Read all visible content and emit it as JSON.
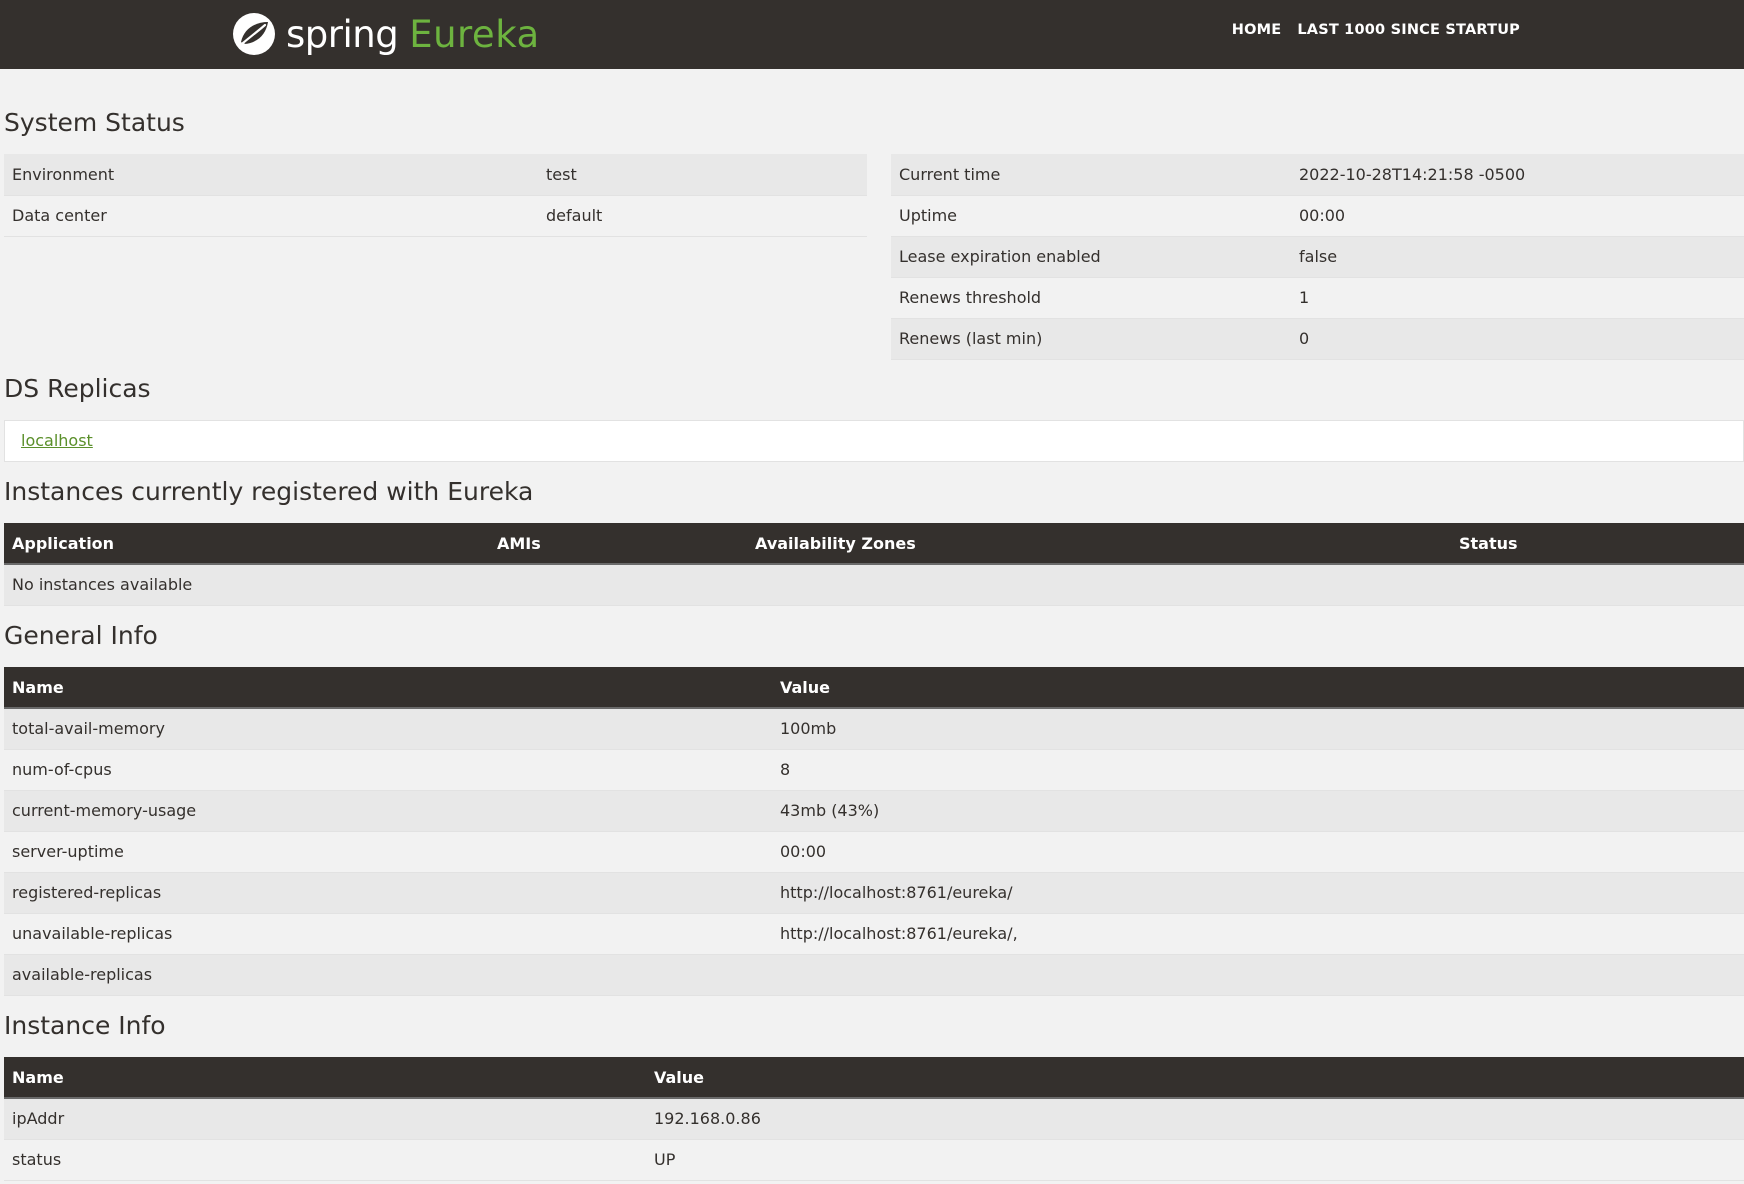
{
  "header": {
    "brand_spring": "spring",
    "brand_eureka": "Eureka",
    "nav": [
      "HOME",
      "LAST 1000 SINCE STARTUP"
    ]
  },
  "system_status": {
    "title": "System Status",
    "left": [
      {
        "name": "Environment",
        "value": "test"
      },
      {
        "name": "Data center",
        "value": "default"
      }
    ],
    "right": [
      {
        "name": "Current time",
        "value": "2022-10-28T14:21:58 -0500"
      },
      {
        "name": "Uptime",
        "value": "00:00"
      },
      {
        "name": "Lease expiration enabled",
        "value": "false"
      },
      {
        "name": "Renews threshold",
        "value": "1"
      },
      {
        "name": "Renews (last min)",
        "value": "0"
      }
    ]
  },
  "ds_replicas": {
    "title": "DS Replicas",
    "items": [
      "localhost"
    ]
  },
  "instances": {
    "title": "Instances currently registered with Eureka",
    "columns": [
      "Application",
      "AMIs",
      "Availability Zones",
      "Status"
    ],
    "empty_text": "No instances available"
  },
  "general_info": {
    "title": "General Info",
    "columns": [
      "Name",
      "Value"
    ],
    "rows": [
      {
        "name": "total-avail-memory",
        "value": "100mb"
      },
      {
        "name": "num-of-cpus",
        "value": "8"
      },
      {
        "name": "current-memory-usage",
        "value": "43mb (43%)"
      },
      {
        "name": "server-uptime",
        "value": "00:00"
      },
      {
        "name": "registered-replicas",
        "value": "http://localhost:8761/eureka/"
      },
      {
        "name": "unavailable-replicas",
        "value": "http://localhost:8761/eureka/,"
      },
      {
        "name": "available-replicas",
        "value": ""
      }
    ]
  },
  "instance_info": {
    "title": "Instance Info",
    "columns": [
      "Name",
      "Value"
    ],
    "rows": [
      {
        "name": "ipAddr",
        "value": "192.168.0.86"
      },
      {
        "name": "status",
        "value": "UP"
      }
    ]
  },
  "colors": {
    "header_bg": "#34302d",
    "brand_green": "#6db33f",
    "link_green": "#5a8f2a",
    "page_bg": "#f2f2f2",
    "stripe_bg": "#e8e8e8"
  }
}
